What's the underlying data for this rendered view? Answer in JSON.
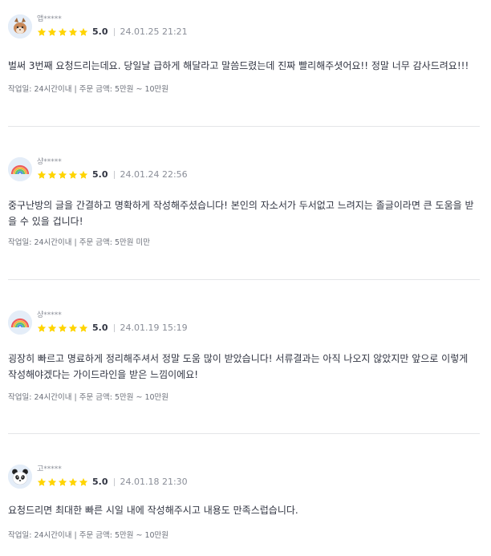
{
  "star_color": "#ffd400",
  "reviews": [
    {
      "avatar": "cat-icon",
      "author": "앱*****",
      "rating": "5.0",
      "date": "24.01.25 21:21",
      "text": "벌써 3번째 요청드리는데요. 당일날 급하게 해달라고 말씀드렸는데 진짜 빨리해주셧어요!! 정말 너무 감사드려요!!!",
      "work_period_label": "작업일: 24시간이내",
      "order_amount_label": "주문 금액: 5만원 ~ 10만원"
    },
    {
      "avatar": "rainbow-icon",
      "author": "샹*****",
      "rating": "5.0",
      "date": "24.01.24 22:56",
      "text": "중구난방의 글을 간결하고 명확하게 작성해주셨습니다! 본인의 자소서가 두서없고 느려지는 졸글이라면 큰 도움을 받을 수 있을 겁니다!",
      "work_period_label": "작업일: 24시간이내",
      "order_amount_label": "주문 금액: 5만원 미만"
    },
    {
      "avatar": "rainbow-icon",
      "author": "샹*****",
      "rating": "5.0",
      "date": "24.01.19 15:19",
      "text": "굉장히 빠르고 명료하게 정리해주셔서 정말 도움 많이 받았습니다! 서류결과는 아직 나오지 않았지만 앞으로 이렇게 작성해야겠다는 가이드라인을 받은 느낌이에요!",
      "work_period_label": "작업일: 24시간이내",
      "order_amount_label": "주문 금액: 5만원 ~ 10만원"
    },
    {
      "avatar": "panda-icon",
      "author": "고*****",
      "rating": "5.0",
      "date": "24.01.18 21:30",
      "text": "요청드리면 최대한 빠른 시일 내에 작성해주시고 내용도 만족스럽습니다.",
      "work_period_label": "작업일: 24시간이내",
      "order_amount_label": "주문 금액: 5만원 ~ 10만원"
    }
  ]
}
